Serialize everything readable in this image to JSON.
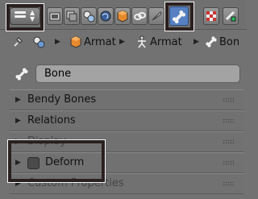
{
  "header": {
    "tabs": [
      {
        "icon": "render-icon",
        "active": false
      },
      {
        "icon": "render-layers-icon",
        "active": false
      },
      {
        "icon": "scene-icon",
        "active": false
      },
      {
        "icon": "world-icon",
        "active": false
      },
      {
        "icon": "object-icon",
        "active": false
      },
      {
        "icon": "constraints-icon",
        "active": false
      },
      {
        "icon": "bone-icon",
        "active": true
      },
      {
        "icon": "texture-icon",
        "active": false
      },
      {
        "icon": "bone-constraint-icon",
        "active": false
      }
    ]
  },
  "breadcrumb": {
    "items": [
      {
        "icon": "pin-icon",
        "label": ""
      },
      {
        "icon": "armature-object-icon",
        "label": "Armat"
      },
      {
        "icon": "armature-data-icon",
        "label": "Armat"
      },
      {
        "icon": "bone-icon",
        "label": "Bon"
      }
    ]
  },
  "name_field": {
    "value": "Bone"
  },
  "panels": [
    {
      "label": "Bendy Bones",
      "expanded": false
    },
    {
      "label": "Relations",
      "expanded": false
    },
    {
      "label": "Display",
      "expanded": false
    },
    {
      "label": "Deform",
      "expanded": false,
      "checkbox": false
    },
    {
      "label": "Custom Properties",
      "expanded": false
    }
  ],
  "colors": {
    "active_tab": "#5680c2",
    "background": "#727272"
  }
}
